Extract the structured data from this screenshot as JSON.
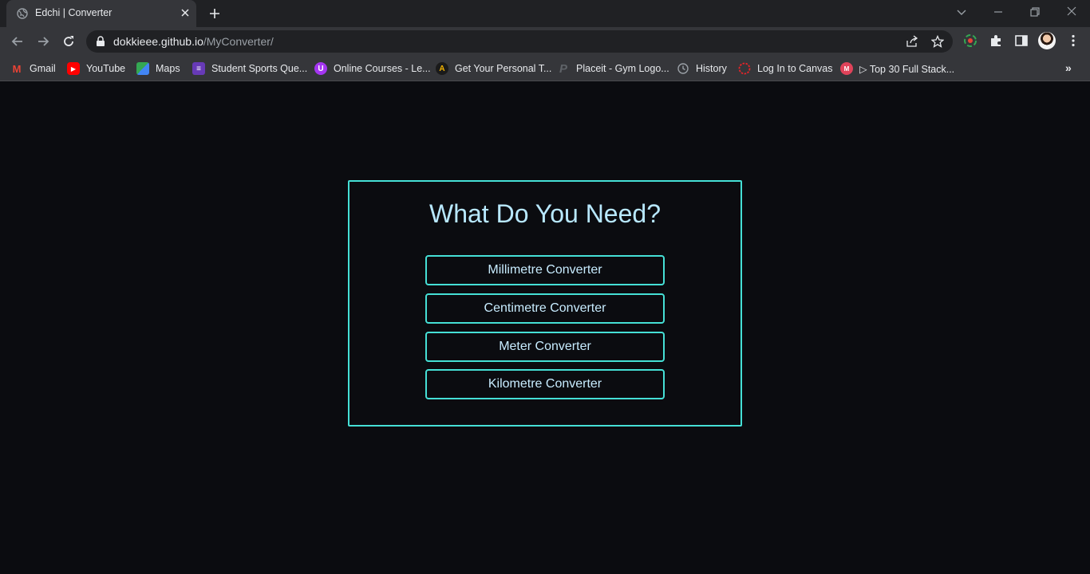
{
  "browser": {
    "tab": {
      "title": "Edchi | Converter"
    },
    "url": {
      "host": "dokkieee.github.io",
      "path": "/MyConverter/"
    },
    "bookmarks": [
      {
        "label": "Gmail",
        "icon": "gmail-icon",
        "color": "#ea4335"
      },
      {
        "label": "YouTube",
        "icon": "youtube-icon",
        "color": "#ff0000"
      },
      {
        "label": "Maps",
        "icon": "maps-icon",
        "color": "#34a853"
      },
      {
        "label": "Student Sports Que...",
        "icon": "forms-icon",
        "color": "#673ab7"
      },
      {
        "label": "Online Courses - Le...",
        "icon": "udemy-icon",
        "color": "#a435f0"
      },
      {
        "label": "Get Your Personal T...",
        "icon": "brand-a-icon",
        "color": "#f5b400"
      },
      {
        "label": "Placeit - Gym Logo...",
        "icon": "placeit-icon",
        "color": "#5f6368"
      },
      {
        "label": "History",
        "icon": "history-icon",
        "color": "#9aa0a6"
      },
      {
        "label": "Log In to Canvas",
        "icon": "canvas-icon",
        "color": "#e72429"
      },
      {
        "label": "▷ Top 30 Full Stack...",
        "icon": "bookmark-red-icon",
        "color": "#e0435a"
      }
    ]
  },
  "page": {
    "heading": "What Do You Need?",
    "buttons": [
      {
        "label": "Millimetre Converter"
      },
      {
        "label": "Centimetre Converter"
      },
      {
        "label": "Meter Converter"
      },
      {
        "label": "Kilometre Converter"
      }
    ],
    "colors": {
      "background": "#0b0c10",
      "accent": "#45e0d6",
      "text": "#b8e8ff"
    }
  }
}
